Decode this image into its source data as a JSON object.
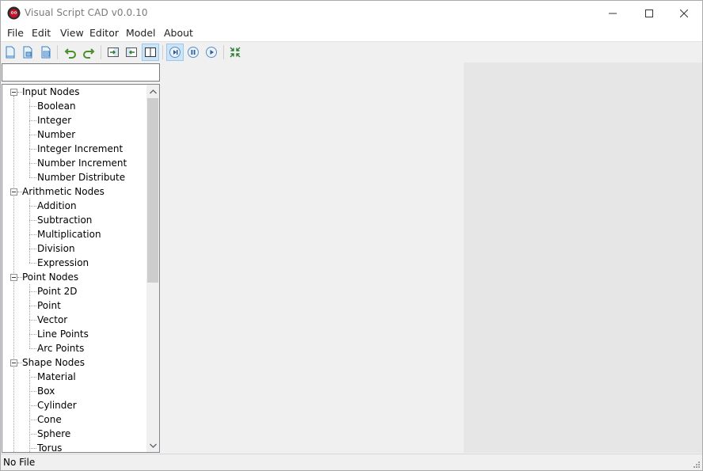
{
  "window": {
    "title": "Visual Script CAD v0.0.10"
  },
  "menu": [
    {
      "label": "File"
    },
    {
      "label": "Edit"
    },
    {
      "label": "View"
    },
    {
      "label": "Editor"
    },
    {
      "label": "Model"
    },
    {
      "label": "About"
    }
  ],
  "toolbar": {
    "buttons": [
      {
        "icon": "new-file-icon"
      },
      {
        "icon": "open-file-icon"
      },
      {
        "icon": "save-file-icon"
      },
      {
        "icon": "undo-icon"
      },
      {
        "icon": "redo-icon"
      },
      {
        "icon": "import-icon"
      },
      {
        "icon": "export-icon"
      },
      {
        "icon": "split-view-icon",
        "active": true
      },
      {
        "icon": "step-icon",
        "active": true
      },
      {
        "icon": "pause-icon"
      },
      {
        "icon": "play-icon"
      },
      {
        "icon": "fit-view-icon"
      }
    ]
  },
  "search": {
    "value": "",
    "placeholder": ""
  },
  "tree": {
    "groups": [
      {
        "label": "Input Nodes",
        "items": [
          "Boolean",
          "Integer",
          "Number",
          "Integer Increment",
          "Number Increment",
          "Number Distribute"
        ]
      },
      {
        "label": "Arithmetic Nodes",
        "items": [
          "Addition",
          "Subtraction",
          "Multiplication",
          "Division",
          "Expression"
        ]
      },
      {
        "label": "Point Nodes",
        "items": [
          "Point 2D",
          "Point",
          "Vector",
          "Line Points",
          "Arc Points"
        ]
      },
      {
        "label": "Shape Nodes",
        "items": [
          "Material",
          "Box",
          "Cylinder",
          "Cone",
          "Sphere",
          "Torus"
        ]
      }
    ]
  },
  "status": {
    "text": "No File"
  },
  "colors": {
    "accent_active": "#cce4f7",
    "canvas_viewport": "#e6e6e6"
  }
}
